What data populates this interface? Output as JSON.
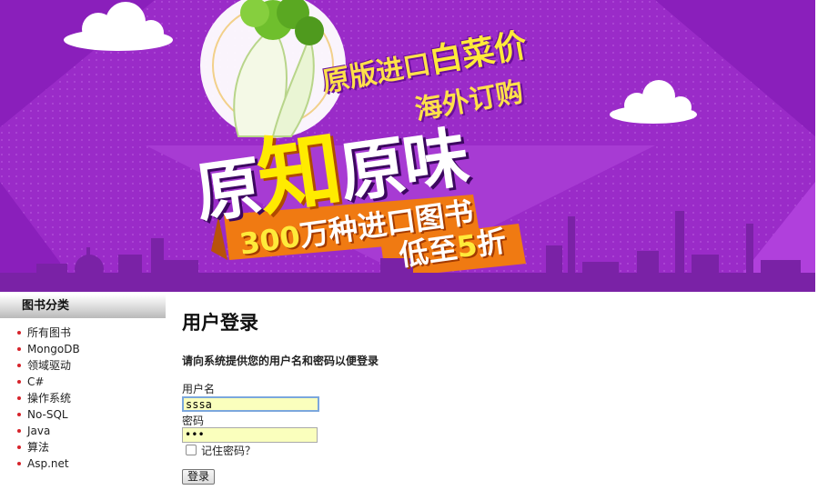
{
  "banner": {
    "slogan_top_prefix": "原版进口",
    "slogan_top_emphasis": "白菜价",
    "slogan_sub": "海外订购",
    "slogan_main_1": "原",
    "slogan_main_accent": "知",
    "slogan_main_2": "原味",
    "count_number": "300",
    "count_text": "万种进口图书",
    "discount_prefix": "低至",
    "discount_number": "5",
    "discount_suffix": "折",
    "colors": {
      "background": "#9a2bc8",
      "accent": "#ffea3a",
      "ribbon": "#f07a12"
    }
  },
  "sidebar": {
    "title": "图书分类",
    "categories": [
      "所有图书",
      "MongoDB",
      "领域驱动",
      "C#",
      "操作系统",
      "No-SQL",
      "Java",
      "算法",
      "Asp.net"
    ]
  },
  "login": {
    "heading": "用户登录",
    "hint": "请向系统提供您的用户名和密码以便登录",
    "username_label": "用户名",
    "username_value": "sssa",
    "password_label": "密码",
    "password_value": "•••",
    "remember_label": "记住密码？",
    "remember_checked": false,
    "submit_label": "登录"
  }
}
